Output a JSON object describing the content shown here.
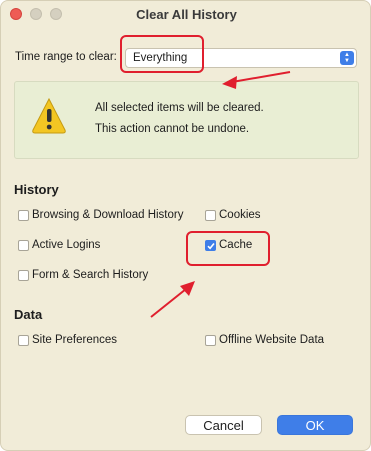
{
  "window": {
    "title": "Clear All History"
  },
  "time_range": {
    "label": "Time range to clear:",
    "selected": "Everything"
  },
  "warning": {
    "icon": "warning-icon",
    "line1": "All selected items will be cleared.",
    "line2": "This action cannot be undone."
  },
  "history": {
    "title": "History",
    "items": [
      {
        "label": "Browsing & Download History",
        "checked": false
      },
      {
        "label": "Cookies",
        "checked": false
      },
      {
        "label": "Active Logins",
        "checked": false
      },
      {
        "label": "Cache",
        "checked": true
      },
      {
        "label": "Form & Search History",
        "checked": false
      }
    ]
  },
  "data": {
    "title": "Data",
    "items": [
      {
        "label": "Site Preferences",
        "checked": false
      },
      {
        "label": "Offline Website Data",
        "checked": false
      }
    ]
  },
  "buttons": {
    "cancel": "Cancel",
    "ok": "OK"
  },
  "colors": {
    "accent": "#3f7ee8",
    "annotation": "#e01f2e",
    "background": "#f1ecd8"
  }
}
